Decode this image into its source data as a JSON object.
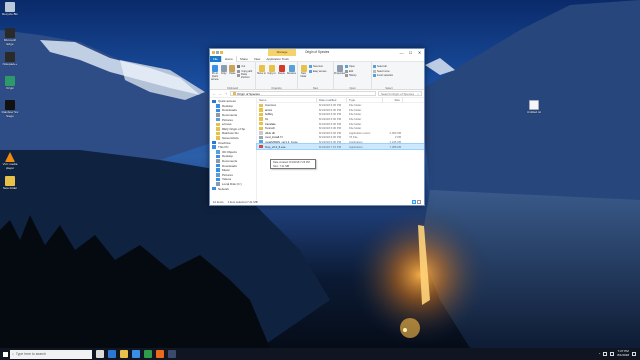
{
  "desktop": {
    "icons_left": [
      {
        "label": "Recycle Bin",
        "icon": "recycle-bin-icon",
        "color": "#b9c9d9"
      },
      {
        "label": "Microsoft Edge",
        "icon": "app-icon",
        "color": "#2a2a2a"
      },
      {
        "label": "Notepad++",
        "icon": "app-icon",
        "color": "#2a2a2a"
      },
      {
        "label": "Origin",
        "icon": "app-icon",
        "color": "#2e9a6a"
      },
      {
        "label": "Rainbow Six Siege",
        "icon": "app-icon",
        "color": "#111111"
      },
      {
        "label": "VLC media player",
        "icon": "vlc-icon",
        "color": "#f08a12"
      },
      {
        "label": "New folder",
        "icon": "folder-icon",
        "color": "#e8c14a"
      }
    ],
    "icon_right": {
      "label": "Untitled.txt",
      "icon": "file-icon"
    }
  },
  "window": {
    "title": "Origin of Species",
    "context_tab": "Manage",
    "controls": {
      "minimize": "—",
      "maximize": "☐",
      "close": "✕"
    },
    "ribbon_tabs": [
      "File",
      "Home",
      "Share",
      "View",
      "Application Tools"
    ],
    "active_tab": "Home",
    "ribbon_groups": [
      {
        "name": "Clipboard",
        "buttons": [
          "Pin to Quick access",
          "Copy",
          "Paste"
        ],
        "small": [
          "Cut",
          "Copy path",
          "Paste shortcut"
        ]
      },
      {
        "name": "Organize",
        "buttons": [
          "Move to",
          "Copy to",
          "Delete",
          "Rename"
        ]
      },
      {
        "name": "New",
        "buttons": [
          "New folder"
        ],
        "small": [
          "New item",
          "Easy access"
        ]
      },
      {
        "name": "Open",
        "buttons": [
          "Properties"
        ],
        "small": [
          "Open",
          "Edit",
          "History"
        ]
      },
      {
        "name": "Select",
        "small": [
          "Select all",
          "Select none",
          "Invert selection"
        ]
      }
    ],
    "address": {
      "back": "←",
      "forward": "→",
      "up": "↑",
      "path": "Origin of Species",
      "search_placeholder": "Search Origin of Species"
    },
    "nav_pane": [
      {
        "label": "Quick access",
        "icon": "star-icon",
        "color": "#2b78d3",
        "top": true
      },
      {
        "label": "Desktop",
        "icon": "desktop-icon",
        "color": "#3a8ee6"
      },
      {
        "label": "Downloads",
        "icon": "download-icon",
        "color": "#3a8ee6"
      },
      {
        "label": "Documents",
        "icon": "documents-icon",
        "color": "#8a9bb0"
      },
      {
        "label": "Pictures",
        "icon": "pictures-icon",
        "color": "#5aa0d8"
      },
      {
        "label": "ecrives",
        "icon": "folder-icon",
        "color": "#e8c14a"
      },
      {
        "label": "REQ Origin of Sp",
        "icon": "folder-icon",
        "color": "#e8c14a"
      },
      {
        "label": "Rainbow Six",
        "icon": "folder-icon",
        "color": "#e8c14a"
      },
      {
        "label": "Screenshots",
        "icon": "folder-icon",
        "color": "#e8c14a"
      },
      {
        "label": "OneDrive",
        "icon": "cloud-icon",
        "color": "#2b78d3",
        "top": true
      },
      {
        "label": "This PC",
        "icon": "pc-icon",
        "color": "#3a8ee6",
        "top": true
      },
      {
        "label": "3D Objects",
        "icon": "cube-icon",
        "color": "#5aa0d8"
      },
      {
        "label": "Desktop",
        "icon": "desktop-icon",
        "color": "#3a8ee6"
      },
      {
        "label": "Documents",
        "icon": "documents-icon",
        "color": "#8a9bb0"
      },
      {
        "label": "Downloads",
        "icon": "download-icon",
        "color": "#3a8ee6"
      },
      {
        "label": "Music",
        "icon": "music-icon",
        "color": "#3a8ee6"
      },
      {
        "label": "Pictures",
        "icon": "pictures-icon",
        "color": "#5aa0d8"
      },
      {
        "label": "Videos",
        "icon": "videos-icon",
        "color": "#3a8ee6"
      },
      {
        "label": "Local Disk (C:)",
        "icon": "drive-icon",
        "color": "#8a9bb0"
      },
      {
        "label": "Network",
        "icon": "network-icon",
        "color": "#3a8ee6",
        "top": true
      }
    ],
    "columns": [
      "Name",
      "Date modified",
      "Type",
      "Size"
    ],
    "files": [
      {
        "name": "Common",
        "date": "8/1/2018 6:00 PM",
        "type": "File folder",
        "size": "",
        "icon": "folder-icon",
        "color": "#e8c14a"
      },
      {
        "name": "anims",
        "date": "8/1/2018 6:00 PM",
        "type": "File folder",
        "size": "",
        "icon": "folder-icon",
        "color": "#e8c14a"
      },
      {
        "name": "boBicy",
        "date": "8/1/2018 6:00 PM",
        "type": "File folder",
        "size": "",
        "icon": "folder-icon",
        "color": "#e8c14a"
      },
      {
        "name": "fnt",
        "date": "8/1/2018 6:00 PM",
        "type": "File folder",
        "size": "",
        "icon": "folder-icon",
        "color": "#e8c14a"
      },
      {
        "name": "translate",
        "date": "8/1/2018 6:00 PM",
        "type": "File folder",
        "size": "",
        "icon": "folder-icon",
        "color": "#e8c14a"
      },
      {
        "name": "Tenroch",
        "date": "8/1/2018 6:00 PM",
        "type": "File folder",
        "size": "",
        "icon": "folder-icon",
        "color": "#e8c14a"
      },
      {
        "name": "d3dx.dll",
        "date": "8/1/2018 6:00 PM",
        "type": "Application exten",
        "size": "2,093 KB",
        "icon": "dll-icon",
        "color": "#c7ccd3"
      },
      {
        "name": "mod_install.7z",
        "date": "8/1/2018 6:00 PM",
        "type": "7Z File",
        "size": "3 KB",
        "icon": "archive-icon",
        "color": "#9aa7b5"
      },
      {
        "name": "moarMAWS_ver1.2_0.exe",
        "date": "8/1/2018 6:00 PM",
        "type": "Application",
        "size": "1,245 KB",
        "icon": "exe-icon",
        "color": "#5aa0d8"
      },
      {
        "name": "Oop_v0.2_5.exe",
        "date": "8/1/2018 7:15 PM",
        "type": "Application",
        "size": "7,388 KB",
        "icon": "exe-icon",
        "color": "#d64a3a",
        "selected": true
      }
    ],
    "tooltip": {
      "line1": "Date created: 8/1/2018 7:26 PM",
      "line2": "Size: 7.21 MB"
    },
    "status": {
      "items": "12 items",
      "selected": "1 item selected  7.21 MB"
    }
  },
  "taskbar": {
    "search_placeholder": "Type here to search",
    "apps": [
      {
        "icon": "task-view-icon",
        "color": "#dcdcdc"
      },
      {
        "icon": "edge-icon",
        "color": "#2b78d3"
      },
      {
        "icon": "file-explorer-icon",
        "color": "#e8c14a"
      },
      {
        "icon": "store-icon",
        "color": "#3a8ee6"
      },
      {
        "icon": "xbox-icon",
        "color": "#2e9a4a"
      },
      {
        "icon": "firefox-icon",
        "color": "#e86a1a"
      },
      {
        "icon": "steam-icon",
        "color": "#3b4a6b"
      }
    ],
    "time": "7:27 PM",
    "date": "8/1/2018"
  }
}
